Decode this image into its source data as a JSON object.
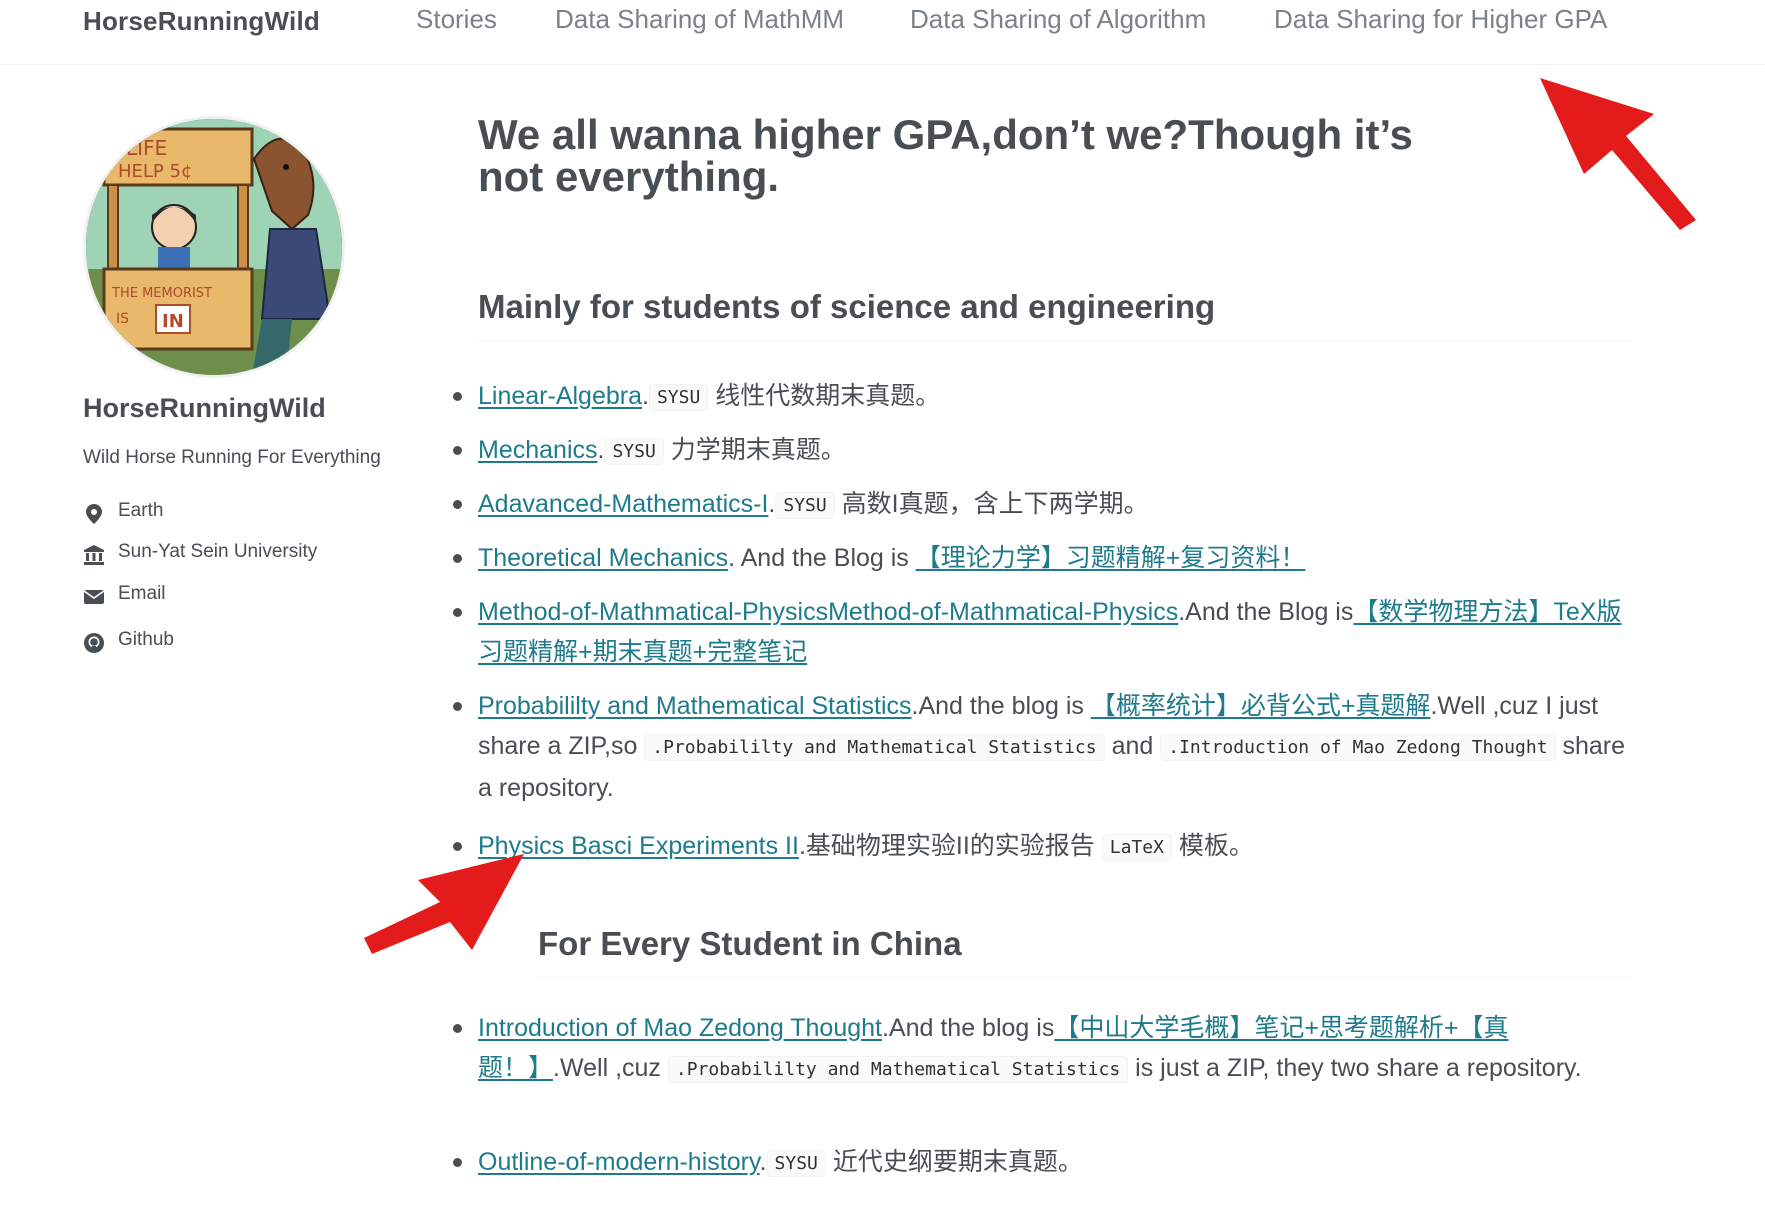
{
  "header": {
    "site_title": "HorseRunningWild",
    "nav": [
      "Stories",
      "Data Sharing of MathMM",
      "Data Sharing of Algorithm",
      "Data Sharing for Higher GPA"
    ]
  },
  "sidebar": {
    "name": "HorseRunningWild",
    "bio": "Wild Horse Running For Everything",
    "links": [
      {
        "icon": "map-marker-icon",
        "label": "Earth"
      },
      {
        "icon": "university-icon",
        "label": "Sun-Yat Sein University"
      },
      {
        "icon": "envelope-icon",
        "label": "Email"
      },
      {
        "icon": "github-icon",
        "label": "Github"
      }
    ]
  },
  "main": {
    "title": "We all wanna higher GPA,don’t we?Though it’s not everything.",
    "section1": {
      "heading": "Mainly for students of science and engineering",
      "items": [
        {
          "link": "Linear-Algebra",
          "a": ".",
          "code": "SYSU",
          "b": " 线性代数期末真题。"
        },
        {
          "link": "Mechanics",
          "a": ".",
          "code": "SYSU",
          "b": " 力学期末真题。"
        },
        {
          "link": "Adavanced-Mathematics-I",
          "a": ".",
          "code": "SYSU",
          "b": " 高数I真题，含上下两学期。"
        },
        {
          "link": "Theoretical Mechanics",
          "a": ". And the Blog is ",
          "link2": "【理论力学】习题精解+复习资料！"
        },
        {
          "link": "Method-of-Mathmatical-PhysicsMethod-of-Mathmatical-Physics",
          "a": ".And the Blog is",
          "link2": "【数学物理方法】TeX版习题精解+期末真题+完整笔记"
        },
        {
          "link": "Probabililty and Mathematical Statistics",
          "a": ".And the blog is ",
          "link2": "【概率统计】必背公式+真题解",
          "b": ".Well ,cuz I just share a ZIP,so ",
          "code1": ".Probabililty and Mathematical Statistics",
          "c": " and ",
          "code2": ".Introduction of Mao Zedong Thought",
          "d": " share a repository."
        },
        {
          "link": "Physics Basci Experiments II",
          "a": ".基础物理实验II的实验报告 ",
          "code": "LaTeX",
          "b": " 模板。"
        }
      ]
    },
    "section2": {
      "heading": "For Every Student in China",
      "items": [
        {
          "link": "Introduction of Mao Zedong Thought",
          "a": ".And the blog is",
          "link2": "【中山大学毛概】笔记+思考题解析+【真题！】",
          "b": ".Well ,cuz ",
          "code": ".Probabililty and Mathematical Statistics",
          "c": " is just a ZIP, they two share a repository."
        },
        {
          "link": "Outline-of-modern-history",
          "a": ".",
          "code": "SYSU",
          "b": " 近代史纲要期末真题。"
        }
      ]
    }
  },
  "colors": {
    "link": "#1e7b8c",
    "text": "#494e52",
    "nav": "#7a8288",
    "annotation_arrow": "#e31b1b"
  }
}
